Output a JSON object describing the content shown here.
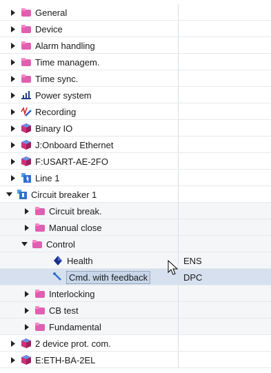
{
  "tree": {
    "rows": [
      {
        "label": "General",
        "value": "",
        "icon": "folder-pink-icon",
        "expanded": false
      },
      {
        "label": "Device",
        "value": "",
        "icon": "folder-pink-icon",
        "expanded": false
      },
      {
        "label": "Alarm handling",
        "value": "",
        "icon": "folder-pink-icon",
        "expanded": false
      },
      {
        "label": "Time managem.",
        "value": "",
        "icon": "folder-pink-icon",
        "expanded": false
      },
      {
        "label": "Time sync.",
        "value": "",
        "icon": "folder-pink-icon",
        "expanded": false
      },
      {
        "label": "Power system",
        "value": "",
        "icon": "power-system-icon",
        "expanded": false
      },
      {
        "label": "Recording",
        "value": "",
        "icon": "recording-icon",
        "expanded": false
      },
      {
        "label": "Binary IO",
        "value": "",
        "icon": "cube-icon",
        "expanded": false
      },
      {
        "label": "J:Onboard Ethernet",
        "value": "",
        "icon": "cube-icon",
        "expanded": false
      },
      {
        "label": "F:USART-AE-2FO",
        "value": "",
        "icon": "cube-icon",
        "expanded": false
      },
      {
        "label": "Line 1",
        "value": "",
        "icon": "line-function-icon",
        "expanded": false
      },
      {
        "label": "Circuit breaker 1",
        "value": "",
        "icon": "circuit-breaker-function-icon",
        "expanded": true
      },
      {
        "label": "Circuit break.",
        "value": "",
        "icon": "folder-pink-icon",
        "expanded": false
      },
      {
        "label": "Manual close",
        "value": "",
        "icon": "folder-pink-icon",
        "expanded": false
      },
      {
        "label": "Control",
        "value": "",
        "icon": "folder-pink-icon",
        "expanded": true
      },
      {
        "label": "Health",
        "value": "ENS",
        "icon": "diamond-icon",
        "expanded": null
      },
      {
        "label": "Cmd. with feedback",
        "value": "DPC",
        "icon": "control-command-icon",
        "expanded": null
      },
      {
        "label": "Interlocking",
        "value": "",
        "icon": "folder-pink-icon",
        "expanded": false
      },
      {
        "label": "CB test",
        "value": "",
        "icon": "folder-pink-icon",
        "expanded": false
      },
      {
        "label": "Fundamental",
        "value": "",
        "icon": "folder-pink-icon",
        "expanded": false
      },
      {
        "label": "2 device prot. com.",
        "value": "",
        "icon": "cube-icon",
        "expanded": false
      },
      {
        "label": "E:ETH-BA-2EL",
        "value": "",
        "icon": "cube-icon",
        "expanded": false
      }
    ]
  },
  "colors": {
    "folder": "#e05fb0",
    "cube": "#d0307a",
    "selection": "#d6e0ee",
    "diamond": "#1b2f8a"
  }
}
